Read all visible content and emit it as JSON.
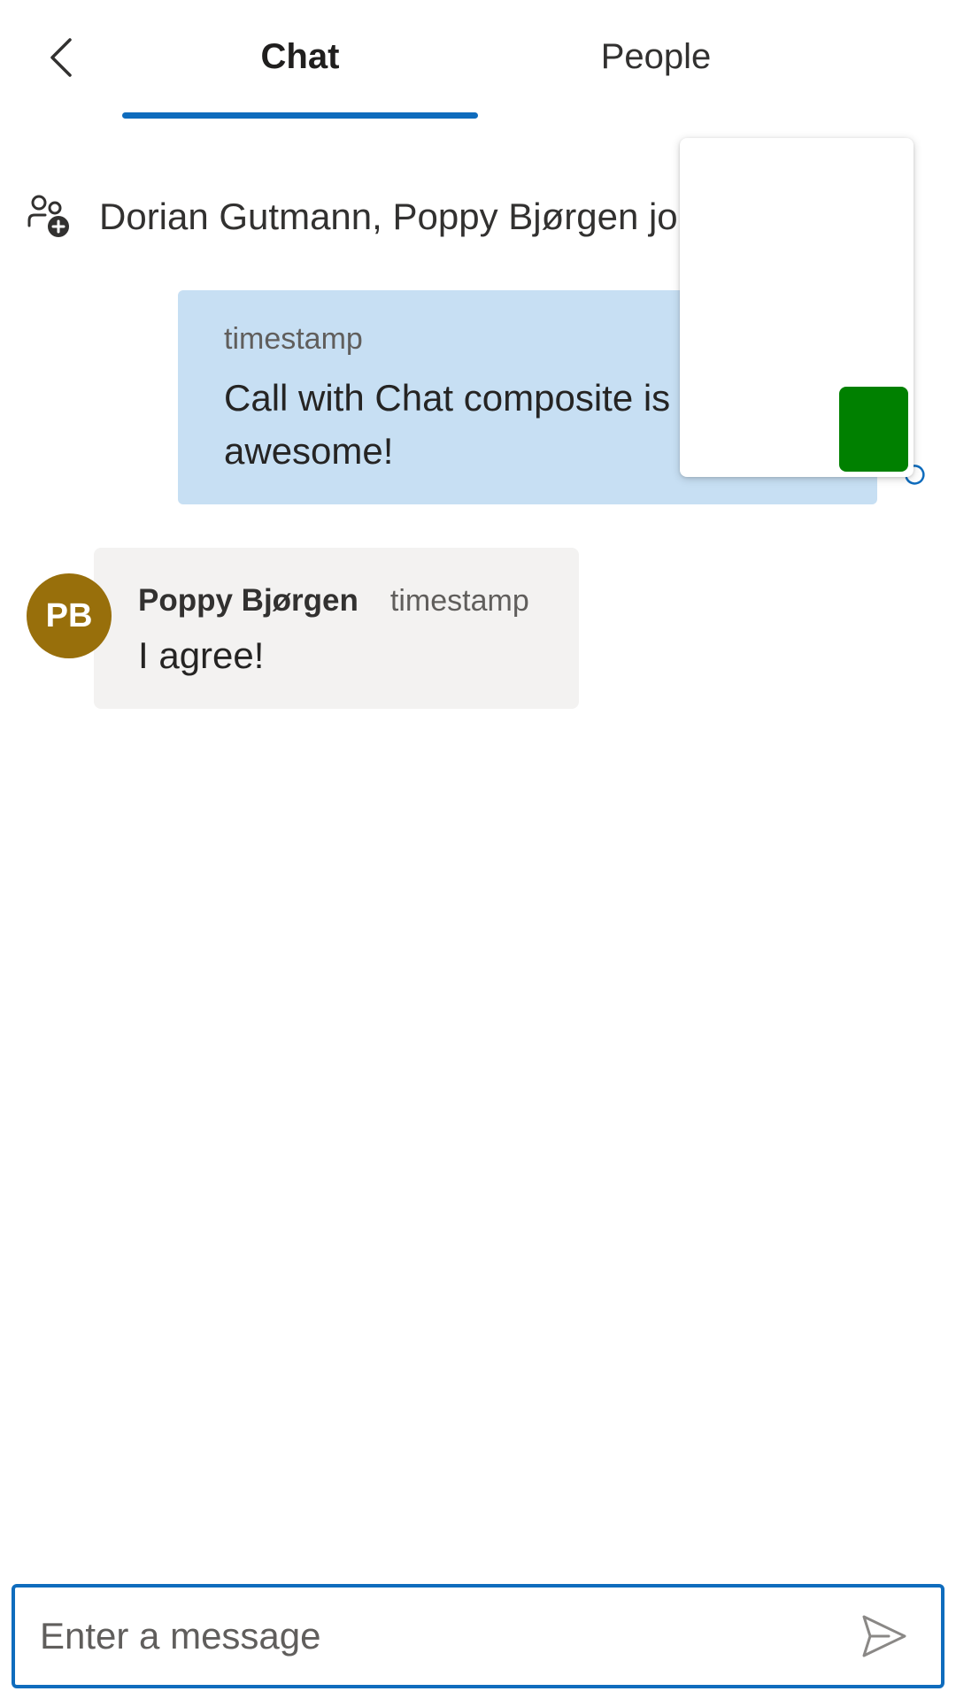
{
  "header": {
    "back_icon": "chevron-left-icon",
    "tabs": [
      {
        "label": "Chat",
        "selected": true
      },
      {
        "label": "People",
        "selected": false
      }
    ]
  },
  "system_message": {
    "icon": "person-add-icon",
    "text": "Dorian Gutmann, Poppy Bjørgen joi"
  },
  "messages": {
    "own": {
      "timestamp": "timestamp",
      "text": "Call with Chat composite is awesome!",
      "status_icon": "sending-status-icon"
    },
    "other": {
      "avatar_initials": "PB",
      "avatar_color": "#986f0b",
      "sender": "Poppy Bjørgen",
      "timestamp": "timestamp",
      "text": "I agree!"
    }
  },
  "video_tile": {
    "local_video_color": "#008000"
  },
  "composer": {
    "placeholder": "Enter a message",
    "value": "",
    "send_icon": "send-icon"
  },
  "colors": {
    "accent": "#0f6cbd",
    "own_bubble": "#c7dff3",
    "other_bubble": "#f3f2f1"
  }
}
